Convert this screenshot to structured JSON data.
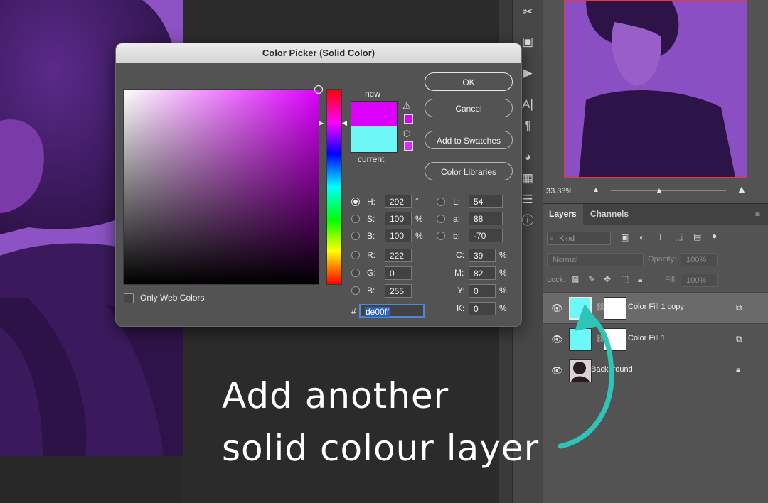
{
  "dialog": {
    "title": "Color Picker (Solid Color)",
    "new_label": "new",
    "current_label": "current",
    "new_color": "#de00ff",
    "current_color": "#6ef7f7",
    "buttons": {
      "ok": "OK",
      "cancel": "Cancel",
      "add_swatches": "Add to Swatches",
      "libraries": "Color Libraries"
    },
    "only_web_colors": "Only Web Colors",
    "hsb": [
      {
        "label": "H:",
        "value": "292",
        "unit": "°",
        "selected": true
      },
      {
        "label": "S:",
        "value": "100",
        "unit": "%",
        "selected": false
      },
      {
        "label": "B:",
        "value": "100",
        "unit": "%",
        "selected": false
      }
    ],
    "rgb": [
      {
        "label": "R:",
        "value": "222"
      },
      {
        "label": "G:",
        "value": "0"
      },
      {
        "label": "B:",
        "value": "255"
      }
    ],
    "lab": [
      {
        "label": "L:",
        "value": "54"
      },
      {
        "label": "a:",
        "value": "88"
      },
      {
        "label": "b:",
        "value": "-70"
      }
    ],
    "cmyk": [
      {
        "label": "C:",
        "value": "39",
        "unit": "%"
      },
      {
        "label": "M:",
        "value": "82",
        "unit": "%"
      },
      {
        "label": "Y:",
        "value": "0",
        "unit": "%"
      },
      {
        "label": "K:",
        "value": "0",
        "unit": "%"
      }
    ],
    "hex_label": "#",
    "hex_value": "de00ff"
  },
  "navigator": {
    "zoom": "33.33%"
  },
  "panel_tabs": {
    "layers": "Layers",
    "channels": "Channels"
  },
  "layers_toolbar": {
    "kind": "Kind",
    "blend_mode": "Normal",
    "opacity_label": "Opacity:",
    "opacity_value": "100%",
    "lock_label": "Lock:",
    "fill_label": "Fill:",
    "fill_value": "100%"
  },
  "layers": [
    {
      "name": "Color Fill 1 copy",
      "color": "#6ef7f7",
      "selected": true
    },
    {
      "name": "Color Fill 1",
      "color": "#6ef7f7",
      "selected": false
    },
    {
      "name": "Background",
      "selected": false
    }
  ],
  "annotation": {
    "line1": "Add another",
    "line2": "solid colour layer",
    "arrow_color": "#2fc4b8"
  }
}
